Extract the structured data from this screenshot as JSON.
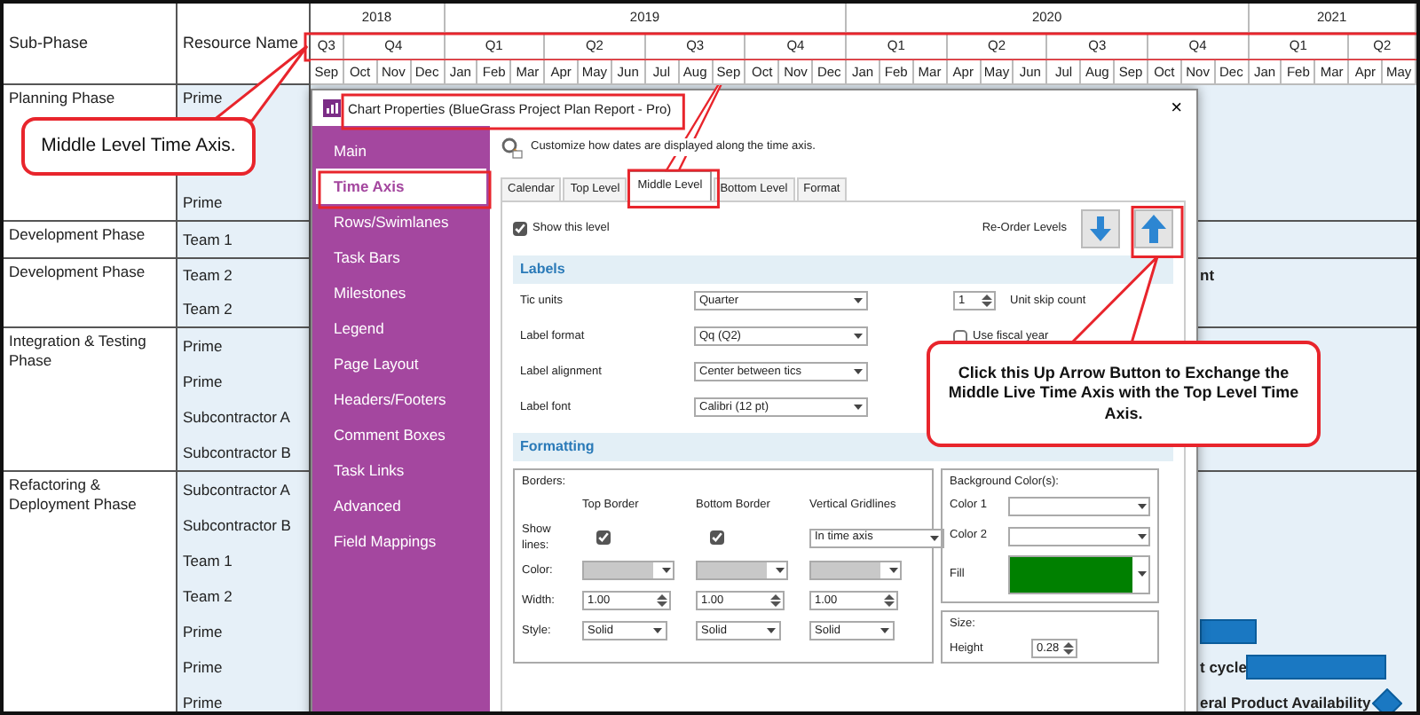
{
  "gantt": {
    "columns": [
      "Sub-Phase",
      "Resource Name"
    ],
    "years": [
      {
        "label": "2018",
        "quarters": [
          {
            "label": "Q3",
            "months": [
              "Sep"
            ]
          },
          {
            "label": "Q4",
            "months": [
              "Oct",
              "Nov",
              "Dec"
            ]
          }
        ]
      },
      {
        "label": "2019",
        "quarters": [
          {
            "label": "Q1",
            "months": [
              "Jan",
              "Feb",
              "Mar"
            ]
          },
          {
            "label": "Q2",
            "months": [
              "Apr",
              "May",
              "Jun"
            ]
          },
          {
            "label": "Q3",
            "months": [
              "Jul",
              "Aug",
              "Sep"
            ]
          },
          {
            "label": "Q4",
            "months": [
              "Oct",
              "Nov",
              "Dec"
            ]
          }
        ]
      },
      {
        "label": "2020",
        "quarters": [
          {
            "label": "Q1",
            "months": [
              "Jan",
              "Feb",
              "Mar"
            ]
          },
          {
            "label": "Q2",
            "months": [
              "Apr",
              "May",
              "Jun"
            ]
          },
          {
            "label": "Q3",
            "months": [
              "Jul",
              "Aug",
              "Sep"
            ]
          },
          {
            "label": "Q4",
            "months": [
              "Oct",
              "Nov",
              "Dec"
            ]
          }
        ]
      },
      {
        "label": "2021",
        "quarters": [
          {
            "label": "Q1",
            "months": [
              "Jan",
              "Feb",
              "Mar"
            ]
          },
          {
            "label": "Q2",
            "months": [
              "Apr",
              "May"
            ]
          }
        ]
      }
    ],
    "phases": [
      {
        "name": "Planning Phase",
        "resources": [
          {
            "name": "Prime"
          },
          {
            "name": "Prime"
          }
        ]
      },
      {
        "name": "Development Phase",
        "resources": [
          {
            "name": "Team 1"
          }
        ]
      },
      {
        "name": "Development Phase",
        "resources": [
          {
            "name": "Team 2",
            "task": {
              "kind": "label",
              "label": "nt"
            }
          },
          {
            "name": "Team 2"
          }
        ]
      },
      {
        "name": "Integration & Testing Phase",
        "resources": [
          {
            "name": "Prime"
          },
          {
            "name": "Prime"
          },
          {
            "name": "Subcontractor A"
          },
          {
            "name": "Subcontractor B"
          }
        ]
      },
      {
        "name": "Refactoring & Deployment Phase",
        "resources": [
          {
            "name": "Subcontractor A"
          },
          {
            "name": "Subcontractor B"
          },
          {
            "name": "Team 1"
          },
          {
            "name": "Team 2"
          },
          {
            "name": "Prime",
            "task": {
              "kind": "bar"
            }
          },
          {
            "name": "Prime",
            "task": {
              "kind": "bar",
              "label": "t cycle"
            }
          },
          {
            "name": "Prime",
            "task": {
              "kind": "milestone",
              "label": "eral Product Availability"
            }
          }
        ]
      }
    ]
  },
  "dialog": {
    "title": "Chart Properties (BlueGrass Project Plan Report - Pro)",
    "close": "×",
    "nav": [
      {
        "label": "Main",
        "selected": false
      },
      {
        "label": "Time Axis",
        "selected": true
      },
      {
        "label": "Rows/Swimlanes",
        "selected": false
      },
      {
        "label": "Task Bars",
        "selected": false
      },
      {
        "label": "Milestones",
        "selected": false
      },
      {
        "label": "Legend",
        "selected": false
      },
      {
        "label": "Page Layout",
        "selected": false
      },
      {
        "label": "Headers/Footers",
        "selected": false
      },
      {
        "label": "Comment Boxes",
        "selected": false
      },
      {
        "label": "Task Links",
        "selected": false
      },
      {
        "label": "Advanced",
        "selected": false
      },
      {
        "label": "Field Mappings",
        "selected": false
      }
    ],
    "description": "Customize how dates are displayed along the time axis.",
    "tabs": [
      {
        "label": "Calendar",
        "selected": false
      },
      {
        "label": "Top Level",
        "selected": false
      },
      {
        "label": "Middle Level",
        "selected": true
      },
      {
        "label": "Bottom Level",
        "selected": false
      },
      {
        "label": "Format",
        "selected": false
      }
    ],
    "show_level": {
      "label": "Show this level",
      "checked": true
    },
    "reorder": {
      "label": "Re-Order Levels"
    },
    "labels": {
      "title": "Labels",
      "rows": [
        {
          "label": "Tic units",
          "value": "Quarter"
        },
        {
          "label": "Label format",
          "value": "Qq (Q2)"
        },
        {
          "label": "Label alignment",
          "value": "Center between tics"
        },
        {
          "label": "Label font",
          "value": "Calibri (12 pt)"
        }
      ],
      "skip": {
        "value": "1",
        "label": "Unit skip count"
      },
      "fiscal": {
        "label": "Use fiscal year",
        "checked": false
      }
    },
    "formatting": {
      "title": "Formatting",
      "borders": {
        "title": "Borders:",
        "columns": [
          "Top Border",
          "Bottom Border",
          "Vertical Gridlines"
        ],
        "show_label": "Show lines:",
        "show": [
          {
            "kind": "checkbox",
            "checked": true
          },
          {
            "kind": "checkbox",
            "checked": true
          },
          {
            "kind": "select",
            "value": "In time axis"
          }
        ],
        "color_label": "Color:",
        "width_label": "Width:",
        "widths": [
          "1.00",
          "1.00",
          "1.00"
        ],
        "style_label": "Style:",
        "styles": [
          "Solid",
          "Solid",
          "Solid"
        ]
      },
      "background": {
        "title": "Background Color(s):",
        "colors": [
          {
            "label": "Color 1"
          },
          {
            "label": "Color 2"
          },
          {
            "label": "Fill",
            "color": "#008000"
          }
        ]
      },
      "size": {
        "title": "Size:",
        "label": "Height",
        "value": "0.28"
      }
    }
  },
  "annotations": [
    {
      "kind": "callout",
      "text": "Middle Level Time Axis."
    },
    {
      "kind": "callout",
      "text": "Click this Up Arrow Button to Exchange the Middle Live Time Axis with the Top Level Time Axis."
    }
  ]
}
